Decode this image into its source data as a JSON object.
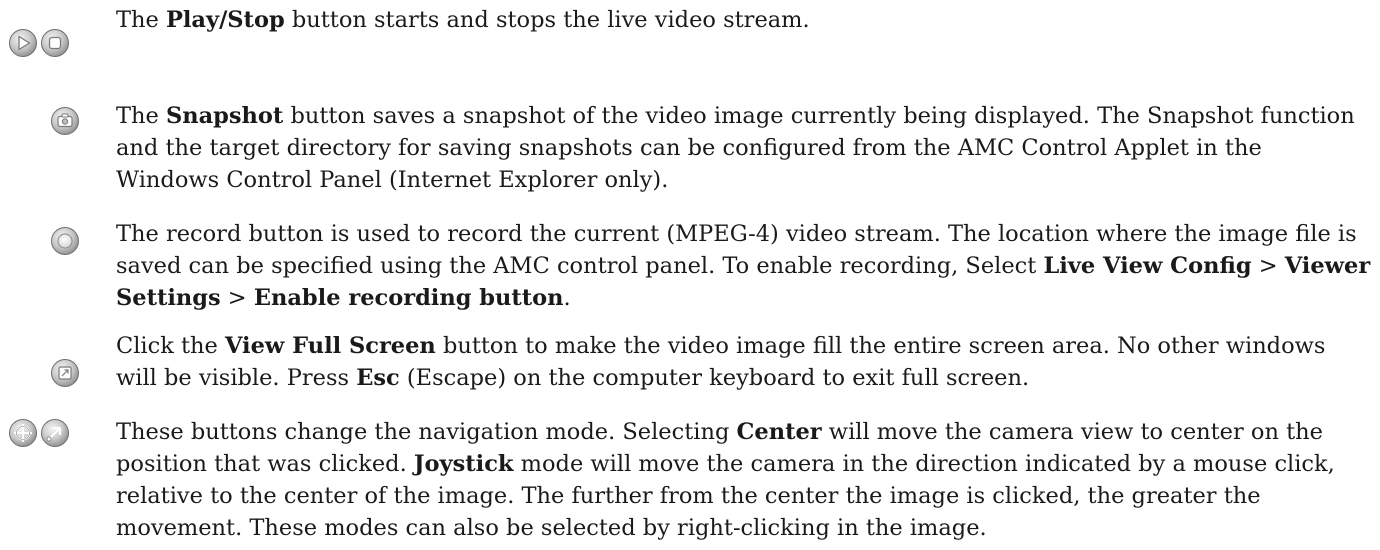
{
  "entries": [
    {
      "icons": [
        "play-icon",
        "stop-icon"
      ],
      "parts": [
        {
          "t": "The ",
          "b": false
        },
        {
          "t": "Play/Stop",
          "b": true
        },
        {
          "t": " button starts and stops the live video stream.",
          "b": false
        }
      ]
    },
    {
      "icons": [
        "snapshot-icon"
      ],
      "parts": [
        {
          "t": "The ",
          "b": false
        },
        {
          "t": "Snapshot",
          "b": true
        },
        {
          "t": " button saves a snapshot of the video image currently being displayed. The Snapshot function and the target directory for saving snapshots can be configured from the AMC Control Applet in the Windows Control Panel (Internet Explorer only).",
          "b": false
        }
      ]
    },
    {
      "icons": [
        "record-icon"
      ],
      "parts": [
        {
          "t": "The record button is used to record the current (MPEG-4) video stream. The location where the image file is saved can be specified using the AMC control panel. To enable recording, Select ",
          "b": false
        },
        {
          "t": "Live View Config",
          "b": true
        },
        {
          "t": " > ",
          "b": false
        },
        {
          "t": "Viewer Settings",
          "b": true
        },
        {
          "t": " > ",
          "b": false
        },
        {
          "t": "Enable recording button",
          "b": true
        },
        {
          "t": ".",
          "b": false
        }
      ]
    },
    {
      "icons": [
        "full-screen-icon"
      ],
      "parts": [
        {
          "t": "Click the ",
          "b": false
        },
        {
          "t": "View Full Screen",
          "b": true
        },
        {
          "t": " button to make the video image fill the entire screen area. No other windows will be visible. Press ",
          "b": false
        },
        {
          "t": "Esc",
          "b": true
        },
        {
          "t": " (Escape) on the computer keyboard to exit full screen.",
          "b": false
        }
      ]
    },
    {
      "icons": [
        "center-mode-icon",
        "joystick-mode-icon"
      ],
      "parts": [
        {
          "t": "These buttons change the navigation mode. Selecting ",
          "b": false
        },
        {
          "t": "Center",
          "b": true
        },
        {
          "t": " will move the camera view to center on the position that was clicked. ",
          "b": false
        },
        {
          "t": "Joystick",
          "b": true
        },
        {
          "t": " mode will move the camera in the direction indicated by a mouse click, relative to the center of the image. The further from the center the image is clicked, the greater the movement. These modes can also be selected by right-clicking in the image.",
          "b": false
        }
      ]
    }
  ]
}
